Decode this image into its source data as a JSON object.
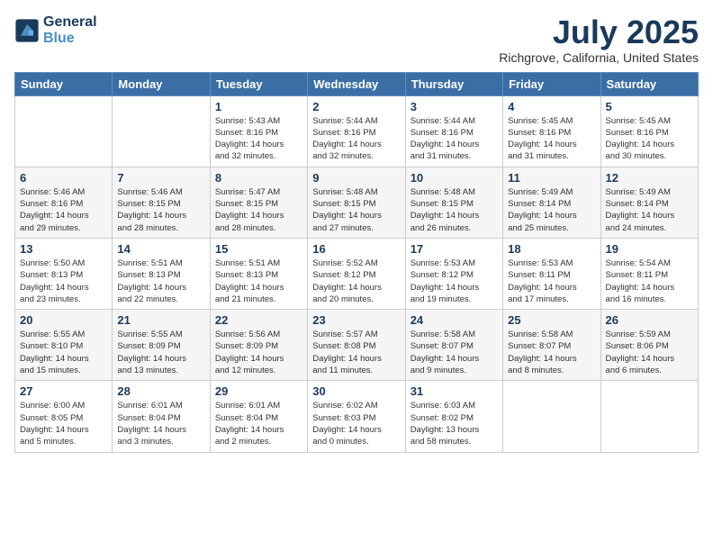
{
  "header": {
    "logo_line1": "General",
    "logo_line2": "Blue",
    "month": "July 2025",
    "location": "Richgrove, California, United States"
  },
  "days_of_week": [
    "Sunday",
    "Monday",
    "Tuesday",
    "Wednesday",
    "Thursday",
    "Friday",
    "Saturday"
  ],
  "weeks": [
    [
      {
        "day": "",
        "info": ""
      },
      {
        "day": "",
        "info": ""
      },
      {
        "day": "1",
        "info": "Sunrise: 5:43 AM\nSunset: 8:16 PM\nDaylight: 14 hours\nand 32 minutes."
      },
      {
        "day": "2",
        "info": "Sunrise: 5:44 AM\nSunset: 8:16 PM\nDaylight: 14 hours\nand 32 minutes."
      },
      {
        "day": "3",
        "info": "Sunrise: 5:44 AM\nSunset: 8:16 PM\nDaylight: 14 hours\nand 31 minutes."
      },
      {
        "day": "4",
        "info": "Sunrise: 5:45 AM\nSunset: 8:16 PM\nDaylight: 14 hours\nand 31 minutes."
      },
      {
        "day": "5",
        "info": "Sunrise: 5:45 AM\nSunset: 8:16 PM\nDaylight: 14 hours\nand 30 minutes."
      }
    ],
    [
      {
        "day": "6",
        "info": "Sunrise: 5:46 AM\nSunset: 8:16 PM\nDaylight: 14 hours\nand 29 minutes."
      },
      {
        "day": "7",
        "info": "Sunrise: 5:46 AM\nSunset: 8:15 PM\nDaylight: 14 hours\nand 28 minutes."
      },
      {
        "day": "8",
        "info": "Sunrise: 5:47 AM\nSunset: 8:15 PM\nDaylight: 14 hours\nand 28 minutes."
      },
      {
        "day": "9",
        "info": "Sunrise: 5:48 AM\nSunset: 8:15 PM\nDaylight: 14 hours\nand 27 minutes."
      },
      {
        "day": "10",
        "info": "Sunrise: 5:48 AM\nSunset: 8:15 PM\nDaylight: 14 hours\nand 26 minutes."
      },
      {
        "day": "11",
        "info": "Sunrise: 5:49 AM\nSunset: 8:14 PM\nDaylight: 14 hours\nand 25 minutes."
      },
      {
        "day": "12",
        "info": "Sunrise: 5:49 AM\nSunset: 8:14 PM\nDaylight: 14 hours\nand 24 minutes."
      }
    ],
    [
      {
        "day": "13",
        "info": "Sunrise: 5:50 AM\nSunset: 8:13 PM\nDaylight: 14 hours\nand 23 minutes."
      },
      {
        "day": "14",
        "info": "Sunrise: 5:51 AM\nSunset: 8:13 PM\nDaylight: 14 hours\nand 22 minutes."
      },
      {
        "day": "15",
        "info": "Sunrise: 5:51 AM\nSunset: 8:13 PM\nDaylight: 14 hours\nand 21 minutes."
      },
      {
        "day": "16",
        "info": "Sunrise: 5:52 AM\nSunset: 8:12 PM\nDaylight: 14 hours\nand 20 minutes."
      },
      {
        "day": "17",
        "info": "Sunrise: 5:53 AM\nSunset: 8:12 PM\nDaylight: 14 hours\nand 19 minutes."
      },
      {
        "day": "18",
        "info": "Sunrise: 5:53 AM\nSunset: 8:11 PM\nDaylight: 14 hours\nand 17 minutes."
      },
      {
        "day": "19",
        "info": "Sunrise: 5:54 AM\nSunset: 8:11 PM\nDaylight: 14 hours\nand 16 minutes."
      }
    ],
    [
      {
        "day": "20",
        "info": "Sunrise: 5:55 AM\nSunset: 8:10 PM\nDaylight: 14 hours\nand 15 minutes."
      },
      {
        "day": "21",
        "info": "Sunrise: 5:55 AM\nSunset: 8:09 PM\nDaylight: 14 hours\nand 13 minutes."
      },
      {
        "day": "22",
        "info": "Sunrise: 5:56 AM\nSunset: 8:09 PM\nDaylight: 14 hours\nand 12 minutes."
      },
      {
        "day": "23",
        "info": "Sunrise: 5:57 AM\nSunset: 8:08 PM\nDaylight: 14 hours\nand 11 minutes."
      },
      {
        "day": "24",
        "info": "Sunrise: 5:58 AM\nSunset: 8:07 PM\nDaylight: 14 hours\nand 9 minutes."
      },
      {
        "day": "25",
        "info": "Sunrise: 5:58 AM\nSunset: 8:07 PM\nDaylight: 14 hours\nand 8 minutes."
      },
      {
        "day": "26",
        "info": "Sunrise: 5:59 AM\nSunset: 8:06 PM\nDaylight: 14 hours\nand 6 minutes."
      }
    ],
    [
      {
        "day": "27",
        "info": "Sunrise: 6:00 AM\nSunset: 8:05 PM\nDaylight: 14 hours\nand 5 minutes."
      },
      {
        "day": "28",
        "info": "Sunrise: 6:01 AM\nSunset: 8:04 PM\nDaylight: 14 hours\nand 3 minutes."
      },
      {
        "day": "29",
        "info": "Sunrise: 6:01 AM\nSunset: 8:04 PM\nDaylight: 14 hours\nand 2 minutes."
      },
      {
        "day": "30",
        "info": "Sunrise: 6:02 AM\nSunset: 8:03 PM\nDaylight: 14 hours\nand 0 minutes."
      },
      {
        "day": "31",
        "info": "Sunrise: 6:03 AM\nSunset: 8:02 PM\nDaylight: 13 hours\nand 58 minutes."
      },
      {
        "day": "",
        "info": ""
      },
      {
        "day": "",
        "info": ""
      }
    ]
  ]
}
